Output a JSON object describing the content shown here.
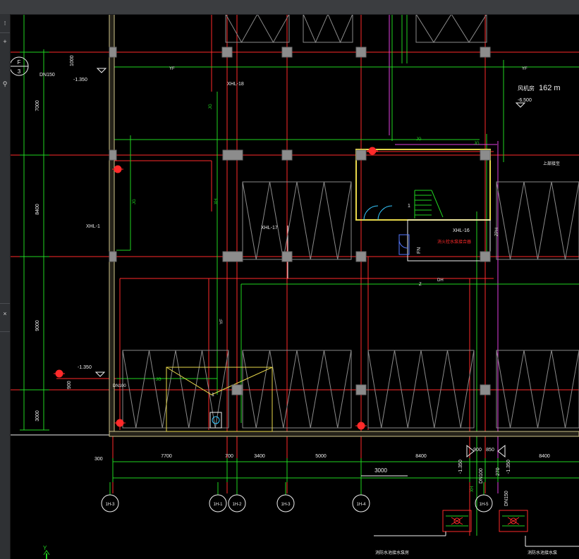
{
  "colors": {
    "red": "#ff2a2a",
    "green": "#21d421",
    "white": "#f0f0f0",
    "yellow": "#e8d84a",
    "wall": "#cfc48a",
    "magenta": "#e040e0",
    "cyan": "#35c8ff",
    "gray": "#8a8a8a",
    "column": "#8c8c8c",
    "blue": "#5577ff"
  },
  "left_toolbar": {
    "icons": [
      "pan-icon",
      "zoom-icon",
      "search-icon"
    ]
  },
  "axis_bubble_f3": {
    "top": "F",
    "bottom": "3"
  },
  "top_labels": {
    "dn150": "DN150",
    "dim_1000": "1000",
    "elev_neg1350": "-1.350",
    "yf_1": "YF",
    "yf_2": "YF",
    "xhl18": "XHL-18",
    "jg_1": "JG",
    "wet_text": "风机房",
    "wet_num": "162 m",
    "elev_neg6500": "-6.500",
    "jg_2": "JG",
    "jg_3": "JG",
    "pipe_label_right": "上部接至",
    "jg_vertical": "JG",
    "xh_vertical": "XH",
    "zp_right": "ZPH"
  },
  "mid_labels": {
    "xhl1": "XHL-1",
    "xhl17": "XHL-17",
    "xhl16": "XHL-16",
    "fire_red": "消火栓水泵接合器",
    "fan_text": "FN",
    "num1": "1",
    "zp": "Z",
    "dh": "DH",
    "yf_mid": "YF",
    "jg_left": "JG",
    "elev_neg1350_b": "-1.350",
    "dim_900": "900",
    "dn100": "DN100",
    "jg_bottom": "JG",
    "num1b": "1"
  },
  "left_dimensions": [
    "7000",
    "8400",
    "9000",
    "3000"
  ],
  "bottom_dimensions": {
    "d300": "300",
    "d7700": "7700",
    "d700": "700",
    "d3400": "3400",
    "d5000": "5000",
    "d8400": "8400",
    "d3000": "3000",
    "d900": "900",
    "d850": "850",
    "d8400b": "8400",
    "d270": "270",
    "e1": "-1.350",
    "e2": "-1.350",
    "dn100": "DN100",
    "dn150": "DN150",
    "xh": "XH"
  },
  "axis_bubbles": [
    "1H-3",
    "1H-1",
    "1H-2",
    "1H-3",
    "1H-4",
    "1H-5"
  ],
  "bottom_texts": {
    "left": "消防水池接水泵房",
    "right": "消防水池接水泵"
  },
  "ucs": {
    "y": "Y"
  }
}
